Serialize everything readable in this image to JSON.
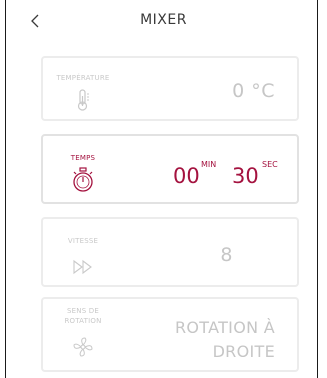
{
  "header": {
    "title": "MIXER",
    "back_icon": "chevron-left-icon"
  },
  "colors": {
    "accent": "#a4123f",
    "inactive_text": "#c6c6c6",
    "card_border": "#ececec"
  },
  "cards": [
    {
      "label": "TEMPÉRATURE",
      "icon": "thermometer-icon",
      "value": "0 °C",
      "active": false
    },
    {
      "label": "TEMPS",
      "icon": "stopwatch-icon",
      "minutes": "00",
      "minutes_unit": "MIN",
      "seconds": "30",
      "seconds_unit": "SEC",
      "active": true
    },
    {
      "label": "VITESSE",
      "icon": "fast-forward-icon",
      "value": "8",
      "active": false
    },
    {
      "label_line1": "SENS DE",
      "label_line2": "ROTATION",
      "icon": "fan-icon",
      "value_line1": "ROTATION À",
      "value_line2": "DROITE",
      "active": false
    }
  ]
}
